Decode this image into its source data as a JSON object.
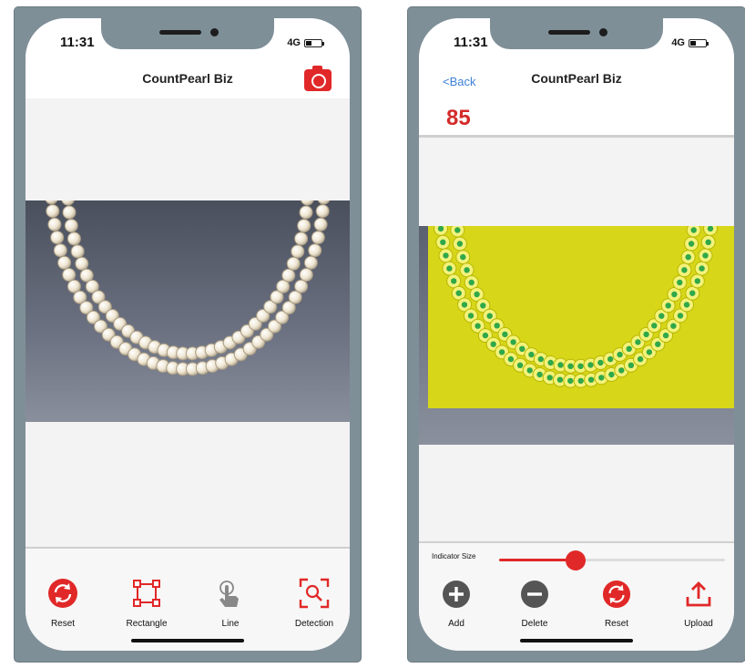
{
  "left_phone": {
    "status": {
      "time": "11:31",
      "network": "4G"
    },
    "title": "CountPearl Biz",
    "toolbar": [
      {
        "label": "Reset",
        "icon": "reset-icon"
      },
      {
        "label": "Rectangle",
        "icon": "rectangle-select-icon"
      },
      {
        "label": "Line",
        "icon": "tap-line-icon"
      },
      {
        "label": "Detection",
        "icon": "detection-scan-icon"
      }
    ]
  },
  "right_phone": {
    "status": {
      "time": "11:31",
      "network": "4G"
    },
    "back_label": "<Back",
    "title": "CountPearl Biz",
    "count": "85",
    "indicator_label": "Indicator Size",
    "indicator_value": 0.34,
    "toolbar": [
      {
        "label": "Add",
        "icon": "add-icon"
      },
      {
        "label": "Delete",
        "icon": "delete-icon"
      },
      {
        "label": "Reset",
        "icon": "reset-icon"
      },
      {
        "label": "Upload",
        "icon": "upload-icon"
      }
    ]
  },
  "colors": {
    "accent": "#e12828",
    "highlight": "#d7d619",
    "marker": "#2fa84a",
    "back_link": "#3d7fd6"
  }
}
